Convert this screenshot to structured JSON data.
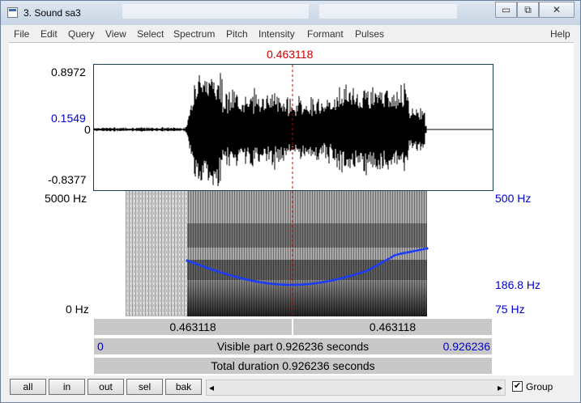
{
  "window": {
    "title": "3. Sound sa3",
    "buttons": {
      "minimize": "▭",
      "maximize": "⧉",
      "close": "✕"
    }
  },
  "menu": [
    "File",
    "Edit",
    "Query",
    "View",
    "Select",
    "Spectrum",
    "Pitch",
    "Intensity",
    "Formant",
    "Pulses"
  ],
  "help": "Help",
  "cursor": {
    "time": "0.463118"
  },
  "waveform": {
    "max": "0.8972",
    "cursor_value": "0.1549",
    "zero": "0",
    "min": "-0.8377"
  },
  "spectrogram": {
    "freq_top": "5000 Hz",
    "freq_bottom": "0 Hz",
    "pitch_top": "500 Hz",
    "pitch_cursor": "186.8 Hz",
    "pitch_bottom": "75 Hz"
  },
  "selection_bar": {
    "left": "0.463118",
    "right": "0.463118"
  },
  "visible_bar": {
    "start": "0",
    "text": "Visible part 0.926236 seconds",
    "end": "0.926236"
  },
  "total_bar": {
    "text": "Total duration 0.926236 seconds"
  },
  "toolbar": {
    "all": "all",
    "in": "in",
    "out": "out",
    "sel": "sel",
    "bak": "bak",
    "scroll_left": "◂",
    "scroll_right": "▸",
    "group_label": "Group",
    "group_checked": "✔"
  },
  "colors": {
    "pitch": "#1a3cff",
    "cursor": "#cc0000",
    "axis_blue": "#0000cc"
  }
}
